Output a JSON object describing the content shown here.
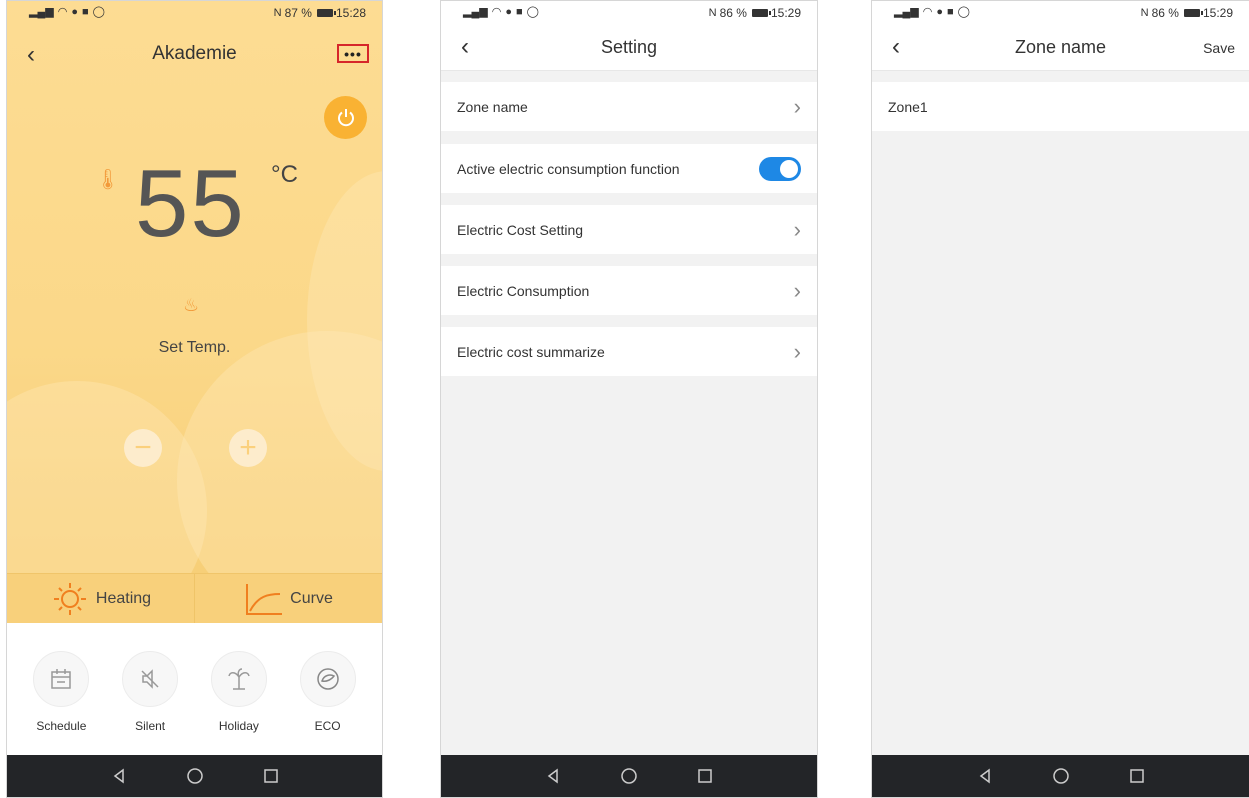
{
  "screens": [
    {
      "status": {
        "battery": "87 %",
        "time": "15:28"
      },
      "title": "Akademie",
      "temperature": "55",
      "unit": "°C",
      "set_temp_label": "Set Temp.",
      "modes": [
        "Heating",
        "Curve"
      ],
      "functions": [
        "Schedule",
        "Silent",
        "Holiday",
        "ECO"
      ]
    },
    {
      "status": {
        "battery": "86 %",
        "time": "15:29"
      },
      "title": "Setting",
      "items": [
        {
          "label": "Zone name"
        },
        {
          "label": "Active electric consumption function"
        },
        {
          "label": "Electric Cost Setting"
        },
        {
          "label": "Electric Consumption"
        },
        {
          "label": "Electric cost summarize"
        }
      ],
      "toggle_on": true
    },
    {
      "status": {
        "battery": "86 %",
        "time": "15:29"
      },
      "title": "Zone name",
      "save_label": "Save",
      "input_value": "Zone1"
    }
  ],
  "colors": {
    "accent": "#f9b233",
    "toggle": "#1e88e5",
    "highlight": "#d6262a"
  }
}
